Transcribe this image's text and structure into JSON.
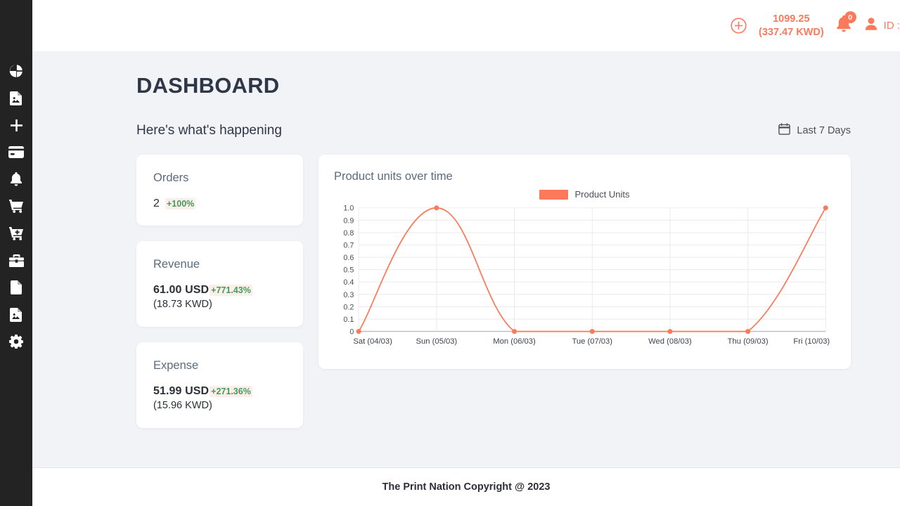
{
  "sidebar": {
    "items": [
      {
        "icon": "pie-chart-icon",
        "name": "sidebar-item-dashboard"
      },
      {
        "icon": "file-image-icon",
        "name": "sidebar-item-media"
      },
      {
        "icon": "plus-icon",
        "name": "sidebar-item-add"
      },
      {
        "icon": "credit-card-icon",
        "name": "sidebar-item-payments"
      },
      {
        "icon": "bell-icon",
        "name": "sidebar-item-notifications"
      },
      {
        "icon": "shopping-cart-icon",
        "name": "sidebar-item-orders"
      },
      {
        "icon": "cart-plus-icon",
        "name": "sidebar-item-new-order"
      },
      {
        "icon": "briefcase-icon",
        "name": "sidebar-item-business"
      },
      {
        "icon": "file-icon",
        "name": "sidebar-item-documents"
      },
      {
        "icon": "file-image-icon",
        "name": "sidebar-item-images"
      },
      {
        "icon": "gear-icon",
        "name": "sidebar-item-settings"
      }
    ]
  },
  "topbar": {
    "add_icon": "circle-plus-icon",
    "balance_primary": "1099.25",
    "balance_secondary": "(337.47 KWD)",
    "bell_icon": "bell-icon",
    "notification_count": "0",
    "user_icon": "user-icon",
    "user_id_label": "ID :"
  },
  "page": {
    "title": "DASHBOARD",
    "subtitle": "Here's what's happening",
    "range_icon": "calendar-icon",
    "range_label": "Last 7 Days"
  },
  "stats": [
    {
      "title": "Orders",
      "value": "2",
      "delta": "+100%",
      "sub": ""
    },
    {
      "title": "Revenue",
      "value": "61.00 USD",
      "delta": "+771.43%",
      "sub": "(18.73 KWD)"
    },
    {
      "title": "Expense",
      "value": "51.99 USD",
      "delta": "+271.36%",
      "sub": "(15.96 KWD)"
    }
  ],
  "chart_data": {
    "type": "line",
    "title": "Product units over time",
    "xlabel": "",
    "ylabel": "",
    "categories": [
      "Sat (04/03)",
      "Sun (05/03)",
      "Mon (06/03)",
      "Tue (07/03)",
      "Wed (08/03)",
      "Thu (09/03)",
      "Fri (10/03)"
    ],
    "series": [
      {
        "name": "Product Units",
        "color": "#FB7A5C",
        "values": [
          0,
          1,
          0,
          0,
          0,
          0,
          1
        ]
      }
    ],
    "yticks": [
      "1.0",
      "0.9",
      "0.8",
      "0.7",
      "0.6",
      "0.5",
      "0.4",
      "0.3",
      "0.2",
      "0.1",
      "0"
    ],
    "ylim": [
      0,
      1
    ],
    "grid": true,
    "legend_position": "top-center",
    "legend_entries": [
      "Product Units"
    ],
    "smoothing": "spline"
  },
  "footer": {
    "text": "The Print Nation Copyright @ 2023"
  },
  "colors": {
    "accent": "#FB7A5C",
    "sidebar_bg": "#232323",
    "canvas_bg": "#F2F3F7",
    "card_bg": "#FFFFFF",
    "title_text": "#2E3748",
    "muted_text": "#5B6B7D",
    "positive": "#3E9D5E",
    "delta_bg": "#FDEEEA"
  }
}
